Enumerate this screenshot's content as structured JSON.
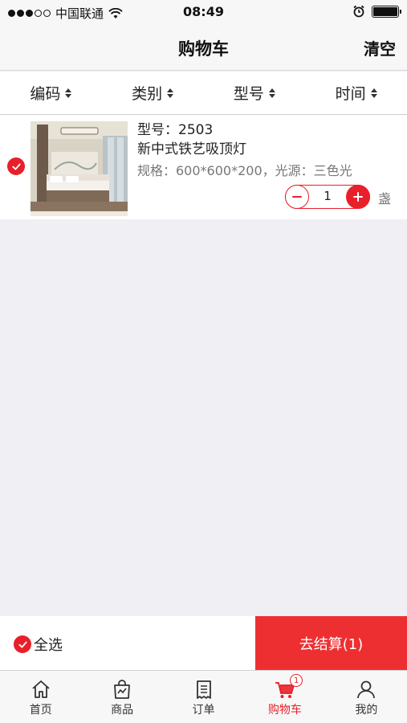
{
  "status_bar": {
    "carrier": "中国联通",
    "time": "08:49",
    "signal_bars_filled": 3,
    "signal_bars_total": 5
  },
  "header": {
    "title": "购物车",
    "clear_label": "清空"
  },
  "sort_bar": {
    "items": [
      {
        "label": "编码"
      },
      {
        "label": "类别"
      },
      {
        "label": "型号"
      },
      {
        "label": "时间"
      }
    ]
  },
  "cart": {
    "items": [
      {
        "model": "型号：2503",
        "name": "新中式铁艺吸顶灯",
        "spec": "规格：600*600*200，光源：三色光",
        "quantity": "1",
        "unit": "盏",
        "selected": true
      }
    ]
  },
  "checkout": {
    "select_all_label": "全选",
    "button_label": "去结算(1)"
  },
  "tab_bar": {
    "items": [
      {
        "label": "首页",
        "icon": "home-icon"
      },
      {
        "label": "商品",
        "icon": "shopping-bag-icon"
      },
      {
        "label": "订单",
        "icon": "order-list-icon"
      },
      {
        "label": "购物车",
        "icon": "cart-icon",
        "badge": "1",
        "active": true
      },
      {
        "label": "我的",
        "icon": "user-icon"
      }
    ]
  },
  "colors": {
    "accent": "#e8202a",
    "checkout_button": "#ee2f32",
    "background": "#efeff4"
  }
}
